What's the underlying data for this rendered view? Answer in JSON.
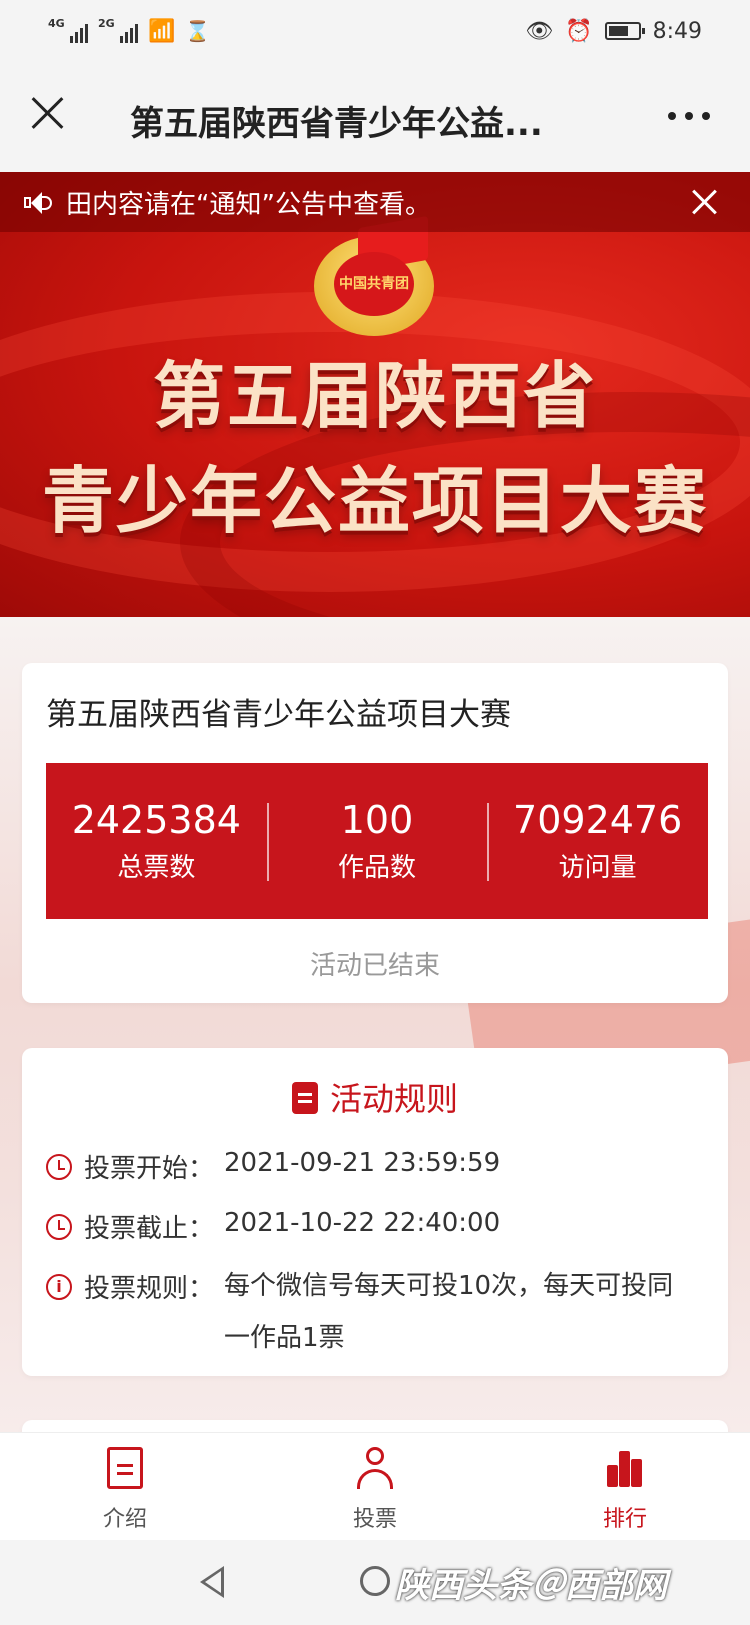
{
  "status_bar": {
    "signal1": "4G",
    "signal2": "2G",
    "time": "8:49",
    "icons": [
      "signal-icon",
      "wifi-icon",
      "hourglass-icon",
      "eye-icon",
      "alarm-icon",
      "battery-icon"
    ]
  },
  "title_bar": {
    "title": "第五届陕西省青少年公益..."
  },
  "notice": {
    "text": "田内容请在“通知”公告中查看。"
  },
  "banner": {
    "emblem_text": "中国共青团",
    "line1": "第五届陕西省",
    "line2": "青少年公益项目大赛"
  },
  "stats_card": {
    "title": "第五届陕西省青少年公益项目大赛",
    "stats": [
      {
        "value": "2425384",
        "label": "总票数"
      },
      {
        "value": "100",
        "label": "作品数"
      },
      {
        "value": "7092476",
        "label": "访问量"
      }
    ],
    "status": "活动已结束"
  },
  "rules": {
    "heading": "活动规则",
    "items": [
      {
        "label": "投票开始：",
        "value": "2021-09-21 23:59:59",
        "icon": "clock-icon"
      },
      {
        "label": "投票截止：",
        "value": "2021-10-22 22:40:00",
        "icon": "clock-icon"
      },
      {
        "label": "投票规则：",
        "value": "每个微信号每天可投10次，每天可投同一作品1票",
        "icon": "info-icon"
      }
    ]
  },
  "tabs": [
    {
      "label": "介绍",
      "icon": "intro-icon",
      "active": false
    },
    {
      "label": "投票",
      "icon": "person-icon",
      "active": false
    },
    {
      "label": "排行",
      "icon": "rank-icon",
      "active": true
    }
  ],
  "watermark": "陕西头条＠西部网",
  "colors": {
    "accent": "#c7151c",
    "banner": "#d41a12",
    "title_text": "#fbe2c6"
  }
}
